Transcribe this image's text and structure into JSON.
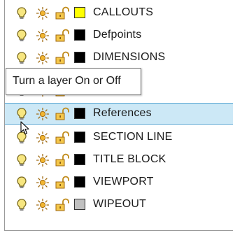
{
  "layers": [
    {
      "name": "CALLOUTS",
      "color": "#ffff00",
      "selected": false
    },
    {
      "name": "Defpoints",
      "color": "#000000",
      "selected": false
    },
    {
      "name": "DIMENSIONS",
      "color": "#000000",
      "selected": false
    },
    {
      "name": "",
      "color": "#000000",
      "selected": false
    },
    {
      "name": "References",
      "color": "#000000",
      "selected": true
    },
    {
      "name": "SECTION LINE",
      "color": "#000000",
      "selected": false
    },
    {
      "name": "TITLE BLOCK",
      "color": "#000000",
      "selected": false
    },
    {
      "name": "VIEWPORT",
      "color": "#000000",
      "selected": false
    },
    {
      "name": "WIPEOUT",
      "color": "#c0c0c0",
      "selected": false
    }
  ],
  "icons": {
    "on_off": "lightbulb-icon",
    "freeze": "sun-icon",
    "lock": "unlocked-padlock-icon"
  },
  "tooltip": {
    "text": "Turn a layer On or Off"
  },
  "colors": {
    "selection_bg": "#cce8f6",
    "selection_border": "#5aa7d3",
    "bulb_on": "#f7e680",
    "sun": "#f2b632"
  }
}
